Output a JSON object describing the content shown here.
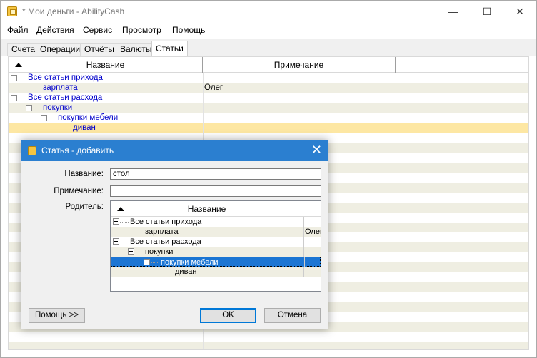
{
  "window": {
    "title": "* Мои деньги - AbilityCash",
    "minimize": "—",
    "maximize": "☐",
    "close": "✕"
  },
  "menu": [
    "Файл",
    "Действия",
    "Сервис",
    "Просмотр",
    "Помощь"
  ],
  "tabs": [
    "Счета",
    "Операции",
    "Отчёты",
    "Валюты",
    "Статьи"
  ],
  "active_tab": "Статьи",
  "grid": {
    "columns": [
      "Название",
      "Примечание"
    ],
    "rows": [
      {
        "name": "Все статьи прихода",
        "note": ""
      },
      {
        "name": "зарплата",
        "note": "Олег"
      },
      {
        "name": "Все статьи расхода",
        "note": ""
      },
      {
        "name": "покупки",
        "note": ""
      },
      {
        "name": "покупки мебели",
        "note": ""
      },
      {
        "name": "диван",
        "note": ""
      }
    ]
  },
  "dialog": {
    "title": "Статья - добавить",
    "close": "✕",
    "name_label": "Название:",
    "name_value": "стол",
    "note_label": "Примечание:",
    "note_value": "",
    "parent_label": "Родитель:",
    "tree_header": "Название",
    "tree_rows": [
      {
        "name": "Все статьи прихода",
        "note": ""
      },
      {
        "name": "зарплата",
        "note": "Олег"
      },
      {
        "name": "Все статьи расхода",
        "note": ""
      },
      {
        "name": "покупки",
        "note": ""
      },
      {
        "name": "покупки мебели",
        "note": ""
      },
      {
        "name": "диван",
        "note": ""
      }
    ],
    "help_button": "Помощь >>",
    "ok_button": "OK",
    "cancel_button": "Отмена"
  },
  "colors": {
    "dialog_title_bar": "#2b7fd0",
    "selected_row": "#fde7a3",
    "tree_selection": "#1b75d3",
    "link": "#0000cc"
  }
}
